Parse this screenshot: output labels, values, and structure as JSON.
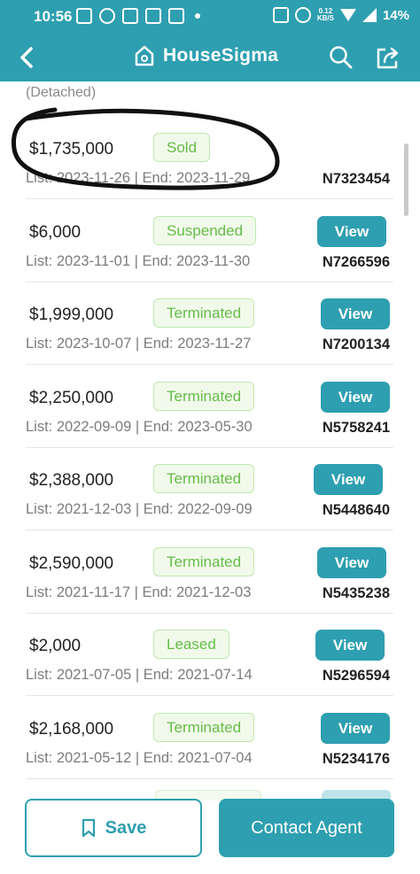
{
  "status_bar": {
    "time": "10:56",
    "network_speed": "0.12\nKB/S",
    "battery": "14%"
  },
  "header": {
    "title": "HouseSigma",
    "icons": [
      "back-arrow-icon",
      "home-logo-icon",
      "search-icon",
      "share-icon"
    ]
  },
  "subtitle": "(Detached)",
  "listings": [
    {
      "price": "$1,735,000",
      "status": "Sold",
      "dates": "List: 2023-11-26 | End: 2023-11-29",
      "mls": "N7323454",
      "has_view": false
    },
    {
      "price": "$6,000",
      "status": "Suspended",
      "dates": "List: 2023-11-01 | End: 2023-11-30",
      "mls": "N7266596",
      "has_view": true
    },
    {
      "price": "$1,999,000",
      "status": "Terminated",
      "dates": "List: 2023-10-07 | End: 2023-11-27",
      "mls": "N7200134",
      "has_view": true
    },
    {
      "price": "$2,250,000",
      "status": "Terminated",
      "dates": "List: 2022-09-09 | End: 2023-05-30",
      "mls": "N5758241",
      "has_view": true
    },
    {
      "price": "$2,388,000",
      "status": "Terminated",
      "dates": "List: 2021-12-03 | End: 2022-09-09",
      "mls": "N5448640",
      "has_view": true
    },
    {
      "price": "$2,590,000",
      "status": "Terminated",
      "dates": "List: 2021-11-17 | End: 2021-12-03",
      "mls": "N5435238",
      "has_view": true
    },
    {
      "price": "$2,000",
      "status": "Leased",
      "dates": "List: 2021-07-05 | End: 2021-07-14",
      "mls": "N5296594",
      "has_view": true
    },
    {
      "price": "$2,168,000",
      "status": "Terminated",
      "dates": "List: 2021-05-12 | End: 2021-07-04",
      "mls": "N5234176",
      "has_view": true
    }
  ],
  "view_label": "View",
  "actions": {
    "save_label": "Save",
    "contact_label": "Contact Agent"
  },
  "colors": {
    "accent": "#2e9fb0",
    "status_green": "#66bb4a",
    "badge_bg": "#f1faea"
  }
}
